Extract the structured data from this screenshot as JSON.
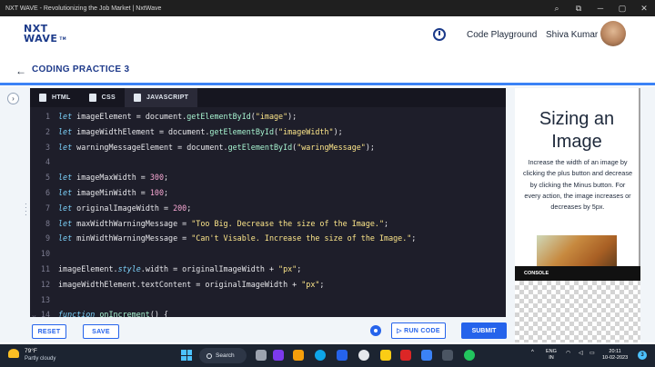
{
  "browser": {
    "title": "NXT WAVE - Revolutionizing the Job Market | NxtWave",
    "controls": [
      "⌕",
      "⧉",
      "─",
      "▢",
      "✕"
    ]
  },
  "header": {
    "logo_line1": "NXT",
    "logo_line2": "WAVE",
    "logo_sub": "TM",
    "nav_link": "Code Playground",
    "username": "Shiva Kumar"
  },
  "subheader": {
    "back": "←",
    "title": "CODING PRACTICE 3"
  },
  "editor": {
    "tabs": [
      {
        "label": "HTML",
        "active": false
      },
      {
        "label": "CSS",
        "active": false
      },
      {
        "label": "JAVASCRIPT",
        "active": true
      }
    ],
    "lines": [
      {
        "n": "1",
        "code": [
          [
            "kw",
            "let"
          ],
          [
            "p",
            " imageElement = document."
          ],
          [
            "fn",
            "getElementById"
          ],
          [
            "p",
            "("
          ],
          [
            "str",
            "\"image\""
          ],
          [
            "p",
            ");"
          ]
        ]
      },
      {
        "n": "2",
        "code": [
          [
            "kw",
            "let"
          ],
          [
            "p",
            " imageWidthElement = document."
          ],
          [
            "fn",
            "getElementById"
          ],
          [
            "p",
            "("
          ],
          [
            "str",
            "\"imageWidth\""
          ],
          [
            "p",
            ");"
          ]
        ]
      },
      {
        "n": "3",
        "code": [
          [
            "kw",
            "let"
          ],
          [
            "p",
            " warningMessageElement = document."
          ],
          [
            "fn",
            "getElementById"
          ],
          [
            "p",
            "("
          ],
          [
            "str",
            "\"waringMessage\""
          ],
          [
            "p",
            ");"
          ]
        ]
      },
      {
        "n": "4",
        "code": []
      },
      {
        "n": "5",
        "code": [
          [
            "kw",
            "let"
          ],
          [
            "p",
            " imageMaxWidth = "
          ],
          [
            "num",
            "300"
          ],
          [
            "p",
            ";"
          ]
        ]
      },
      {
        "n": "6",
        "code": [
          [
            "kw",
            "let"
          ],
          [
            "p",
            " imageMinWidth = "
          ],
          [
            "num",
            "100"
          ],
          [
            "p",
            ";"
          ]
        ]
      },
      {
        "n": "7",
        "code": [
          [
            "kw",
            "let"
          ],
          [
            "p",
            " originalImageWidth = "
          ],
          [
            "num",
            "200"
          ],
          [
            "p",
            ";"
          ]
        ]
      },
      {
        "n": "8",
        "code": [
          [
            "kw",
            "let"
          ],
          [
            "p",
            " maxWidthWarningMessage = "
          ],
          [
            "str",
            "\"Too Big. Decrease the size of the Image.\""
          ],
          [
            "p",
            ";"
          ]
        ]
      },
      {
        "n": "9",
        "code": [
          [
            "kw",
            "let"
          ],
          [
            "p",
            " minWidthWarningMessage = "
          ],
          [
            "str",
            "\"Can't Visable. Increase the size of the Image.\""
          ],
          [
            "p",
            ";"
          ]
        ]
      },
      {
        "n": "10",
        "code": []
      },
      {
        "n": "11",
        "code": [
          [
            "p",
            "imageElement."
          ],
          [
            "kw",
            "style"
          ],
          [
            "p",
            ".width = originalImageWidth + "
          ],
          [
            "str",
            "\"px\""
          ],
          [
            "p",
            ";"
          ]
        ]
      },
      {
        "n": "12",
        "code": [
          [
            "p",
            "imageWidthElement.textContent = originalImageWidth + "
          ],
          [
            "str",
            "\"px\""
          ],
          [
            "p",
            ";"
          ]
        ]
      },
      {
        "n": "13",
        "code": []
      },
      {
        "n": "⌄ 14",
        "code": [
          [
            "kw",
            "function"
          ],
          [
            "p",
            " "
          ],
          [
            "fn",
            "onIncrement"
          ],
          [
            "p",
            "() {"
          ]
        ]
      }
    ]
  },
  "preview": {
    "title": "Sizing an Image",
    "description": "Increase the width of an image by clicking the plus button and decrease by clicking the Minus button. For every action, the image increases or decreases by 5px.",
    "console_label": "CONSOLE"
  },
  "actions": {
    "reset": "RESET",
    "save": "SAVE",
    "run": "▷ RUN CODE",
    "submit": "SUBMIT"
  },
  "taskbar": {
    "temp": "79°F",
    "weather": "Partly cloudy",
    "search": "Search",
    "lang_line1": "ENG",
    "lang_line2": "IN",
    "time": "20:11",
    "date": "10-02-2023",
    "notifications": "3",
    "tray_arrow": "^"
  }
}
